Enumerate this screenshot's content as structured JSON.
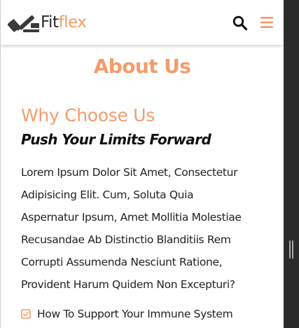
{
  "navbar": {
    "brand_part1": "Fit",
    "brand_part2": "flex",
    "logo_icon": "dumbbell-icon",
    "search_icon": "search-icon",
    "menu_icon": "hamburger-menu-icon"
  },
  "about": {
    "title": "About Us",
    "subtitle": "Why Choose Us",
    "tagline": "Push Your Limits Forward",
    "body_lines": [
      "Lorem Ipsum Dolor Sit Amet, Consectetur",
      "Adipisicing Elit. Cum, Soluta Quia",
      "Aspernatur Ipsum, Amet Mollitia Molestiae",
      "Recusandae Ab Distinctio Blanditiis Rem",
      "Corrupti Assumenda Nesciunt Ratione,",
      "Provident Harum Quidem Non Excepturi?"
    ],
    "checklist": [
      {
        "icon": "checkbox-checked-icon",
        "label": "How To Support Your Immune System"
      }
    ]
  },
  "colors": {
    "accent": "#f39c6b",
    "text_dark": "#111111",
    "scrollbar": "#2b2b2b"
  }
}
